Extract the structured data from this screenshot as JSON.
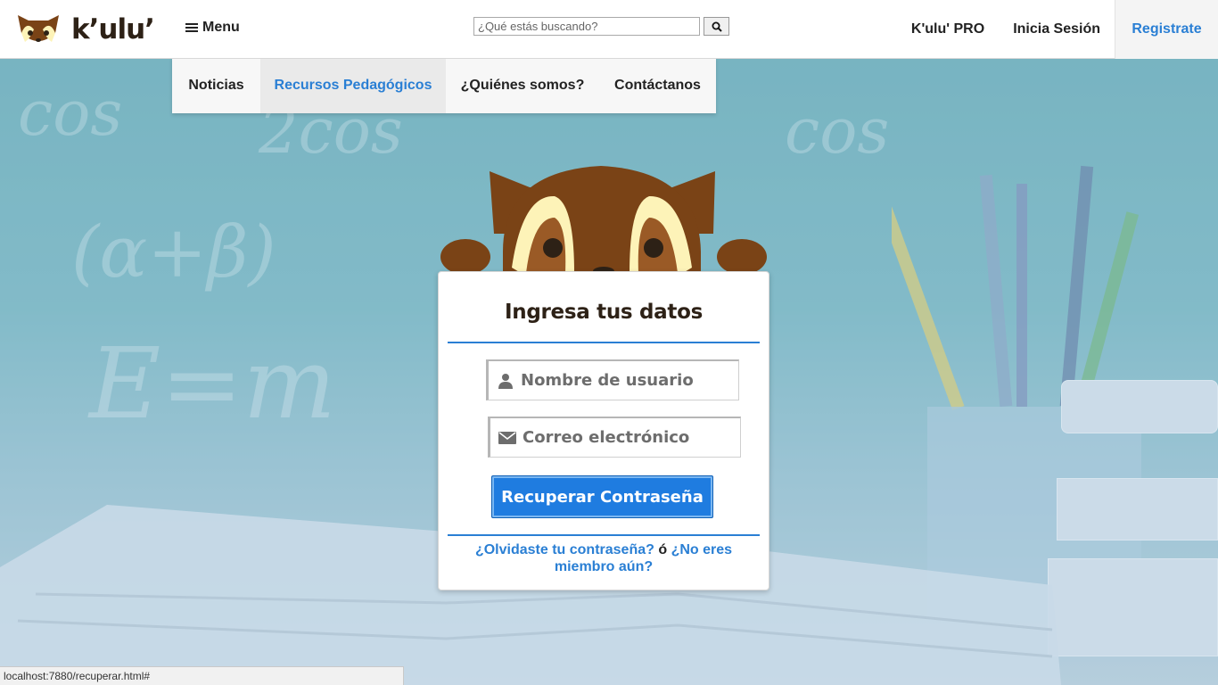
{
  "brand": {
    "name": "k’ulu’",
    "logo_icon": "raccoon-logo-icon"
  },
  "header": {
    "menu_label": "Menu",
    "search": {
      "placeholder": "¿Qué estás buscando?",
      "button_icon": "search-icon"
    },
    "nav_right": [
      "K'ulu' PRO",
      "Inicia Sesión",
      "Registrate"
    ]
  },
  "dropdown": {
    "items": [
      "Noticias",
      "Recursos Pedagógicos",
      "¿Quiénes somos?",
      "Contáctanos"
    ],
    "active": "Recursos Pedagógicos"
  },
  "form": {
    "title": "Ingresa tus datos",
    "username_placeholder": "Nombre de usuario",
    "email_placeholder": "Correo electrónico",
    "submit_label": "Recuperar Contraseña",
    "forgot_link": "¿Olvidaste tu contraseña?",
    "separator": "ó",
    "signup_link": "¿No eres miembro aún?"
  },
  "status_bar": {
    "url": "localhost:7880/recuperar.html#"
  },
  "colors": {
    "accent": "#2a7fd4",
    "button": "#1f7ce0",
    "brand_brown": "#7a4316",
    "brand_cream": "#fdf3b8"
  }
}
